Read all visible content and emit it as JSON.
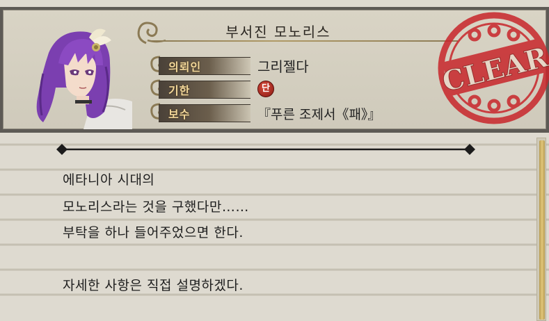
{
  "quest": {
    "title": "부서진 모노리스",
    "client_label": "의뢰인",
    "client_value": "그리젤다",
    "deadline_label": "기한",
    "deadline_badge": "단",
    "reward_label": "보수",
    "reward_value": "『푸른 조제서《패》』",
    "stamp_text": "CLEAR"
  },
  "message": {
    "lines": [
      "에타니아 시대의",
      "모노리스라는 것을 구했다만……",
      "부탁을 하나 들어주었으면 한다.",
      "",
      "자세한 사항은 직접 설명하겠다."
    ]
  },
  "colors": {
    "label_text": "#f2d79a",
    "stamp_red": "#c8262b",
    "badge_red": "#b02a20",
    "scroll_gold": "#d4b465"
  },
  "icons": [
    "scroll-ornament-icon",
    "diamond-icon",
    "clear-stamp-icon"
  ]
}
